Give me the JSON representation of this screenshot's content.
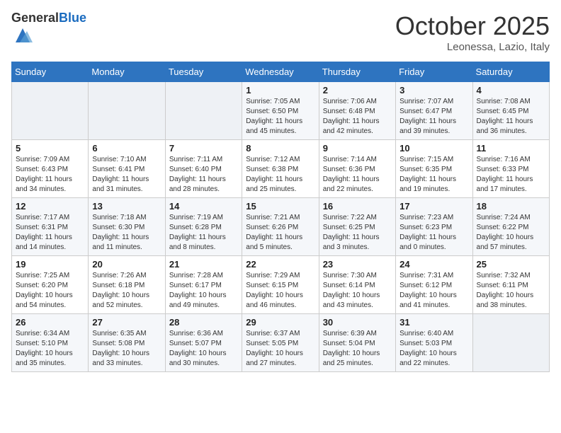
{
  "header": {
    "logo_general": "General",
    "logo_blue": "Blue",
    "month_title": "October 2025",
    "location": "Leonessa, Lazio, Italy"
  },
  "weekdays": [
    "Sunday",
    "Monday",
    "Tuesday",
    "Wednesday",
    "Thursday",
    "Friday",
    "Saturday"
  ],
  "weeks": [
    [
      {
        "day": "",
        "info": ""
      },
      {
        "day": "",
        "info": ""
      },
      {
        "day": "",
        "info": ""
      },
      {
        "day": "1",
        "info": "Sunrise: 7:05 AM\nSunset: 6:50 PM\nDaylight: 11 hours\nand 45 minutes."
      },
      {
        "day": "2",
        "info": "Sunrise: 7:06 AM\nSunset: 6:48 PM\nDaylight: 11 hours\nand 42 minutes."
      },
      {
        "day": "3",
        "info": "Sunrise: 7:07 AM\nSunset: 6:47 PM\nDaylight: 11 hours\nand 39 minutes."
      },
      {
        "day": "4",
        "info": "Sunrise: 7:08 AM\nSunset: 6:45 PM\nDaylight: 11 hours\nand 36 minutes."
      }
    ],
    [
      {
        "day": "5",
        "info": "Sunrise: 7:09 AM\nSunset: 6:43 PM\nDaylight: 11 hours\nand 34 minutes."
      },
      {
        "day": "6",
        "info": "Sunrise: 7:10 AM\nSunset: 6:41 PM\nDaylight: 11 hours\nand 31 minutes."
      },
      {
        "day": "7",
        "info": "Sunrise: 7:11 AM\nSunset: 6:40 PM\nDaylight: 11 hours\nand 28 minutes."
      },
      {
        "day": "8",
        "info": "Sunrise: 7:12 AM\nSunset: 6:38 PM\nDaylight: 11 hours\nand 25 minutes."
      },
      {
        "day": "9",
        "info": "Sunrise: 7:14 AM\nSunset: 6:36 PM\nDaylight: 11 hours\nand 22 minutes."
      },
      {
        "day": "10",
        "info": "Sunrise: 7:15 AM\nSunset: 6:35 PM\nDaylight: 11 hours\nand 19 minutes."
      },
      {
        "day": "11",
        "info": "Sunrise: 7:16 AM\nSunset: 6:33 PM\nDaylight: 11 hours\nand 17 minutes."
      }
    ],
    [
      {
        "day": "12",
        "info": "Sunrise: 7:17 AM\nSunset: 6:31 PM\nDaylight: 11 hours\nand 14 minutes."
      },
      {
        "day": "13",
        "info": "Sunrise: 7:18 AM\nSunset: 6:30 PM\nDaylight: 11 hours\nand 11 minutes."
      },
      {
        "day": "14",
        "info": "Sunrise: 7:19 AM\nSunset: 6:28 PM\nDaylight: 11 hours\nand 8 minutes."
      },
      {
        "day": "15",
        "info": "Sunrise: 7:21 AM\nSunset: 6:26 PM\nDaylight: 11 hours\nand 5 minutes."
      },
      {
        "day": "16",
        "info": "Sunrise: 7:22 AM\nSunset: 6:25 PM\nDaylight: 11 hours\nand 3 minutes."
      },
      {
        "day": "17",
        "info": "Sunrise: 7:23 AM\nSunset: 6:23 PM\nDaylight: 11 hours\nand 0 minutes."
      },
      {
        "day": "18",
        "info": "Sunrise: 7:24 AM\nSunset: 6:22 PM\nDaylight: 10 hours\nand 57 minutes."
      }
    ],
    [
      {
        "day": "19",
        "info": "Sunrise: 7:25 AM\nSunset: 6:20 PM\nDaylight: 10 hours\nand 54 minutes."
      },
      {
        "day": "20",
        "info": "Sunrise: 7:26 AM\nSunset: 6:18 PM\nDaylight: 10 hours\nand 52 minutes."
      },
      {
        "day": "21",
        "info": "Sunrise: 7:28 AM\nSunset: 6:17 PM\nDaylight: 10 hours\nand 49 minutes."
      },
      {
        "day": "22",
        "info": "Sunrise: 7:29 AM\nSunset: 6:15 PM\nDaylight: 10 hours\nand 46 minutes."
      },
      {
        "day": "23",
        "info": "Sunrise: 7:30 AM\nSunset: 6:14 PM\nDaylight: 10 hours\nand 43 minutes."
      },
      {
        "day": "24",
        "info": "Sunrise: 7:31 AM\nSunset: 6:12 PM\nDaylight: 10 hours\nand 41 minutes."
      },
      {
        "day": "25",
        "info": "Sunrise: 7:32 AM\nSunset: 6:11 PM\nDaylight: 10 hours\nand 38 minutes."
      }
    ],
    [
      {
        "day": "26",
        "info": "Sunrise: 6:34 AM\nSunset: 5:10 PM\nDaylight: 10 hours\nand 35 minutes."
      },
      {
        "day": "27",
        "info": "Sunrise: 6:35 AM\nSunset: 5:08 PM\nDaylight: 10 hours\nand 33 minutes."
      },
      {
        "day": "28",
        "info": "Sunrise: 6:36 AM\nSunset: 5:07 PM\nDaylight: 10 hours\nand 30 minutes."
      },
      {
        "day": "29",
        "info": "Sunrise: 6:37 AM\nSunset: 5:05 PM\nDaylight: 10 hours\nand 27 minutes."
      },
      {
        "day": "30",
        "info": "Sunrise: 6:39 AM\nSunset: 5:04 PM\nDaylight: 10 hours\nand 25 minutes."
      },
      {
        "day": "31",
        "info": "Sunrise: 6:40 AM\nSunset: 5:03 PM\nDaylight: 10 hours\nand 22 minutes."
      },
      {
        "day": "",
        "info": ""
      }
    ]
  ]
}
